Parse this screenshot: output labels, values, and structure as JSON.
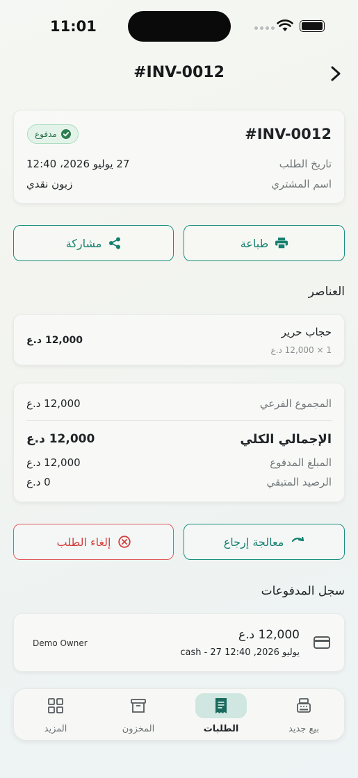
{
  "status_bar": {
    "time": "11:01"
  },
  "nav": {
    "title": "#INV-0012"
  },
  "summary": {
    "invoice_number": "#INV-0012",
    "status": "مدفوع",
    "order_date_label": "تاريخ الطلب",
    "order_date_value": "27 يوليو 2026، 12:40",
    "buyer_label": "اسم المشتري",
    "buyer_value": "زبون نقدي"
  },
  "actions": {
    "print": "طباعة",
    "share": "مشاركة"
  },
  "items_section": {
    "title": "العناصر",
    "items": [
      {
        "name": "حجاب حرير",
        "detail": "1 × 12,000 د.ع",
        "total": "12,000 د.ع"
      }
    ]
  },
  "totals": {
    "subtotal_label": "المجموع الفرعي",
    "subtotal_value": "12,000 د.ع",
    "grand_total_label": "الإجمالي الكلي",
    "grand_total_value": "12,000 د.ع",
    "paid_label": "المبلغ المدفوع",
    "paid_value": "12,000 د.ع",
    "remaining_label": "الرصيد المتبقي",
    "remaining_value": "0 د.ع"
  },
  "order_actions": {
    "refund": "معالجة إرجاع",
    "cancel": "إلغاء الطلب"
  },
  "payments_section": {
    "title": "سجل المدفوعات",
    "payments": [
      {
        "amount": "12,000 د.ع",
        "detail": "cash - 27 يوليو 2026, 12:40",
        "user": "Demo Owner"
      }
    ]
  },
  "tab_bar": {
    "tabs": [
      {
        "label": "بيع جديد",
        "icon": "cash-register-icon",
        "active": false
      },
      {
        "label": "الطلبات",
        "icon": "receipt-icon",
        "active": true
      },
      {
        "label": "المخزون",
        "icon": "archive-box-icon",
        "active": false
      },
      {
        "label": "المزيد",
        "icon": "grid-icon",
        "active": false
      }
    ]
  },
  "colors": {
    "accent": "#1a8f7e",
    "danger": "#e05b5b",
    "paid_badge_bg": "#e4f3ea",
    "active_tab_bg": "#cfe6e1"
  }
}
